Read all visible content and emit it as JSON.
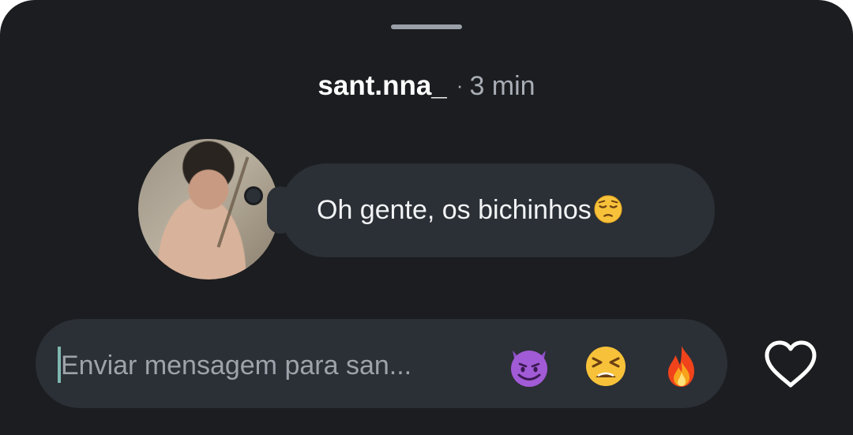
{
  "header": {
    "username": "sant.nna_",
    "separator": "·",
    "time": "3 min"
  },
  "message": {
    "text": "Oh gente, os bichinhos",
    "trailing_emoji": "pensive-face"
  },
  "composer": {
    "placeholder": "Enviar mensagem para san...",
    "quick_reactions": [
      "smiling-face-with-horns",
      "tired-face",
      "fire"
    ]
  },
  "actions": {
    "like_icon": "heart-icon"
  },
  "colors": {
    "background": "#1b1d20",
    "bubble": "#2b2f36",
    "text_primary": "#ffffff",
    "text_secondary": "#a9aeb6",
    "caret": "#7fb8b0"
  }
}
